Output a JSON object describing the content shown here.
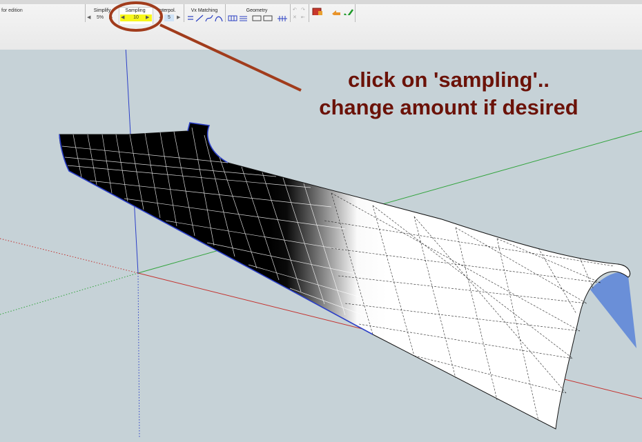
{
  "toolbar": {
    "edition_label": "for edition",
    "simplify": {
      "title": "Simplify",
      "value": "5%"
    },
    "sampling": {
      "title": "Sampling",
      "value": "10"
    },
    "interpol": {
      "title": "Interpol.",
      "value": "5"
    },
    "vx_matching": {
      "title": "Vx Matching"
    },
    "geometry": {
      "title": "Geometry"
    },
    "icons": [
      "undo-icon",
      "redo-icon",
      "close-icon",
      "cancel-icon",
      "exit-icon",
      "back-icon",
      "validate-check-icon"
    ]
  },
  "annotation": {
    "line1": "click on 'sampling'..",
    "line2": "change amount if desired",
    "color": "#6b1208",
    "circle_color": "#a13c1c"
  },
  "scene": {
    "background": "#c6d2d7",
    "axis_colors": {
      "red": "#c4302c",
      "green": "#2fa33a",
      "blue": "#2b3fc8"
    }
  }
}
